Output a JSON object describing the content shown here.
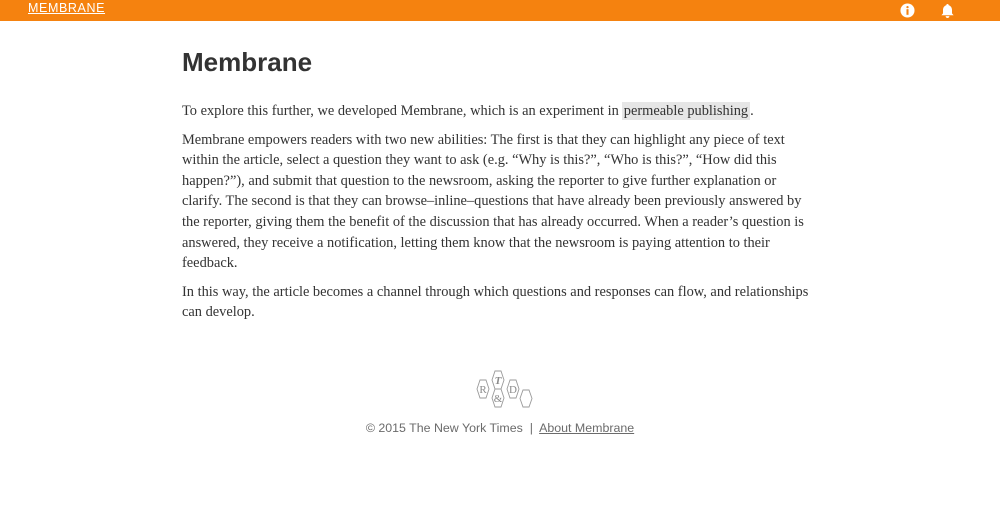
{
  "topbar": {
    "brand": "MEMBRANE",
    "info_icon": "info-icon",
    "bell_icon": "bell-icon",
    "accent_color": "#f5820f"
  },
  "article": {
    "title": "Membrane",
    "p1_before": "To explore this further, we developed Membrane, which is an experiment in",
    "p1_highlight": "permeable publishing",
    "p1_after": ".",
    "p2_lines": [
      "Membrane empowers readers with two new abilities: The first is that they can highlight any piece of text",
      "within the article, select a question they want to ask (e.g. “Why is this?”, “Who is this?”, “How did this",
      "happen?”), and submit that question to the newsroom, asking the reporter to give further explanation or",
      "clarify. The second is that they can browse–inline–questions that have already been previously answered by",
      "the reporter, giving them the benefit of the discussion that has already occurred. When a reader’s question is",
      "answered, they receive a notification, letting them know that the newsroom is paying attention to their",
      "feedback."
    ],
    "p3_lines": [
      "In this way, the article becomes a channel through which questions and responses can flow, and relationships",
      "can develop."
    ]
  },
  "footer": {
    "logo_letters": {
      "top": "T",
      "left": "R",
      "middle": "&",
      "right": "D"
    },
    "copyright": "© 2015 The New York Times",
    "separator": "|",
    "about_link": "About Membrane"
  }
}
